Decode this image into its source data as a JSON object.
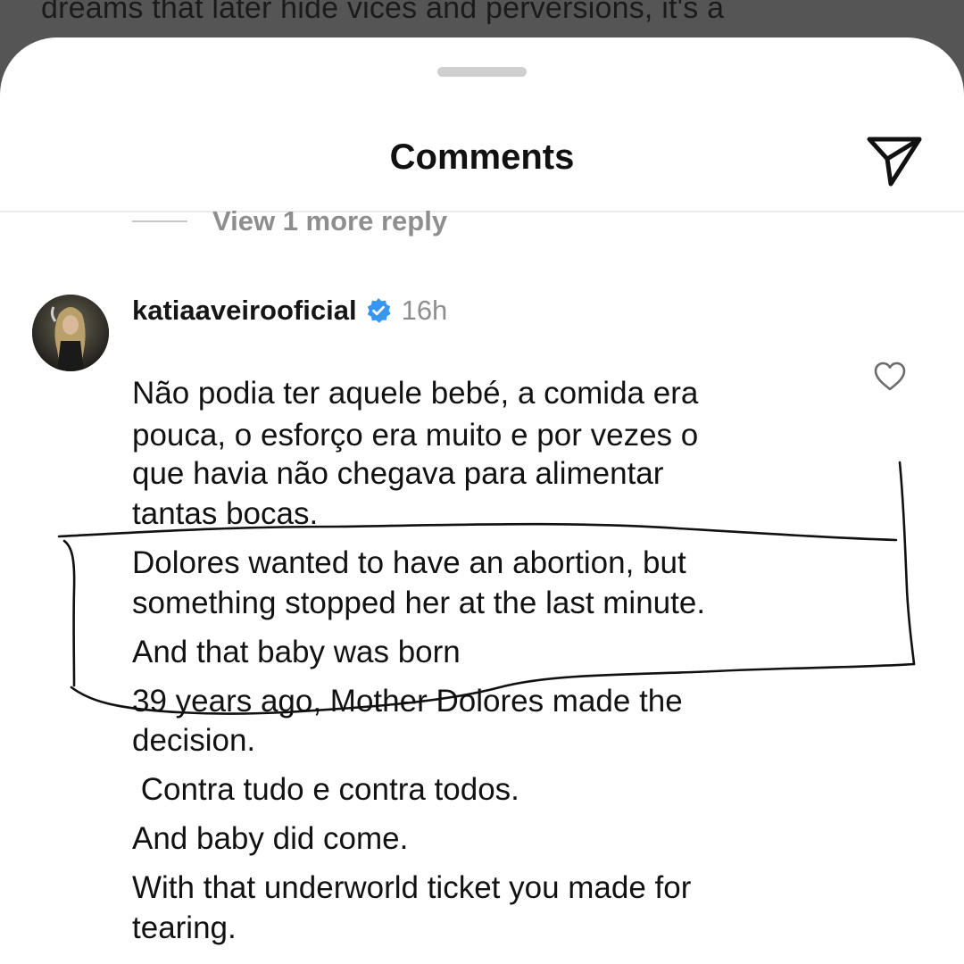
{
  "background_post": {
    "visible_text": "dreams that later hide vices and perversions, it's a"
  },
  "sheet": {
    "title": "Comments"
  },
  "icons": {
    "share": "paper-plane-icon",
    "verified": "verified-badge-icon",
    "like": "heart-outline-icon"
  },
  "replies": {
    "view_more_label": "View 1 more reply"
  },
  "comment": {
    "username": "katiaaveirooficial",
    "time": "16h",
    "lines": [
      "Não podia ter aquele bebé, a comida era",
      "pouca, o esforço era muito e por vezes o",
      "que havia não chegava para alimentar",
      "tantas bocas.",
      "Dolores wanted to have an abortion, but",
      "something stopped her at the last minute.",
      "And that baby was born",
      "39 years ago, Mother Dolores made the",
      "decision.",
      " Contra tudo e contra todos.",
      "And baby did come.",
      "With that underworld ticket you made for",
      "tearing."
    ]
  },
  "colors": {
    "overlay": "#555555",
    "verified_blue": "#3797f0",
    "muted_text": "#8e8e8e",
    "annotation_ink": "#111111"
  }
}
